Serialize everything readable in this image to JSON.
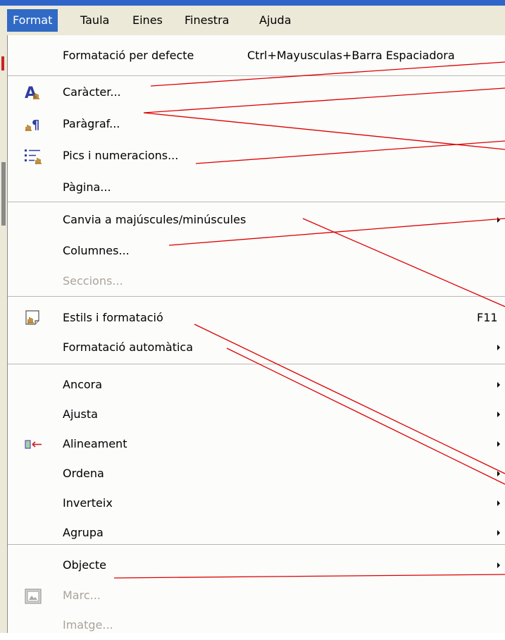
{
  "menubar": {
    "items": [
      {
        "label": "Format",
        "active": true
      },
      {
        "label": "Taula"
      },
      {
        "label": "Eines"
      },
      {
        "label": "Finestra"
      },
      {
        "label": "Ajuda"
      }
    ]
  },
  "menu": {
    "default_formatting": {
      "label": "Formatació per defecte",
      "shortcut": "Ctrl+Mayusculas+Barra Espaciadora"
    },
    "character": {
      "label": "Caràcter..."
    },
    "paragraph": {
      "label": "Paràgraf..."
    },
    "bullets": {
      "label": "Pics i numeracions..."
    },
    "page": {
      "label": "Pàgina..."
    },
    "change_case": {
      "label": "Canvia a majúscules/minúscules"
    },
    "columns": {
      "label": "Columnes..."
    },
    "sections": {
      "label": "Seccions..."
    },
    "styles": {
      "label": "Estils i formatació",
      "shortcut": "F11"
    },
    "autoformat": {
      "label": "Formatació automàtica"
    },
    "anchor": {
      "label": "Ancora"
    },
    "wrap": {
      "label": "Ajusta"
    },
    "alignment": {
      "label": "Alineament"
    },
    "arrange": {
      "label": "Ordena"
    },
    "flip": {
      "label": "Inverteix"
    },
    "group": {
      "label": "Agrupa"
    },
    "object": {
      "label": "Objecte"
    },
    "frame": {
      "label": "Marc..."
    },
    "image": {
      "label": "Imatge..."
    }
  },
  "colors": {
    "menu_highlight": "#316ac5",
    "annotation_line": "#dd0000",
    "disabled_text": "#aaa49a",
    "menubar_bg": "#ece9d8"
  },
  "icons": {
    "character": "character-icon",
    "paragraph": "paragraph-icon",
    "bullets": "bullets-numbering-icon",
    "styles": "styles-formatting-icon",
    "alignment": "alignment-icon",
    "frame": "frame-icon"
  }
}
